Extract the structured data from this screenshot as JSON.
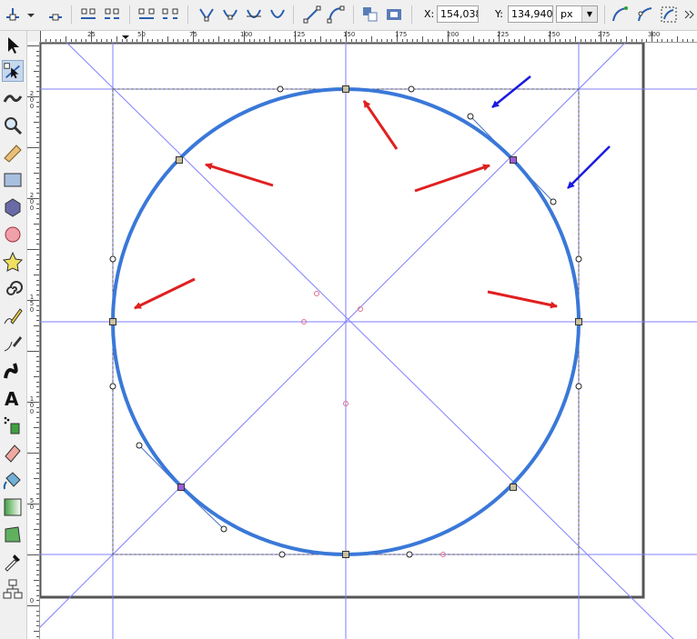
{
  "toolbar": {
    "x_label": "X:",
    "x_value": "154,038",
    "y_label": "Y:",
    "y_value": "134,940",
    "unit_value": "px"
  },
  "rulers": {
    "horizontal": [
      "25",
      "50",
      "75",
      "100",
      "125",
      "150",
      "175",
      "200",
      "225",
      "250",
      "275",
      "300"
    ],
    "vertical": [
      "2\n0\n0",
      "2\n0\n0",
      "1\n5\n0",
      "1\n0\n0",
      "5\n0",
      "0"
    ]
  },
  "tools": [
    "selector-tool",
    "node-tool",
    "tweak-tool",
    "zoom-tool",
    "measure-tool",
    "rect-tool",
    "3dbox-tool",
    "ellipse-tool",
    "star-tool",
    "spiral-tool",
    "pencil-tool",
    "pen-tool",
    "calligraphy-tool",
    "text-tool",
    "spray-tool",
    "eraser-tool",
    "paint-bucket-tool",
    "gradient-tool",
    "mesh-tool",
    "dropper-tool",
    "connector-tool"
  ],
  "colors": {
    "circle_stroke": "#3a78d8",
    "guide": "#7f7fff",
    "red_arrow": "#e02020",
    "blue_arrow": "#1a1ae0",
    "node_fill": "#c8c0a0",
    "selected_node": "#9b5bd6"
  }
}
